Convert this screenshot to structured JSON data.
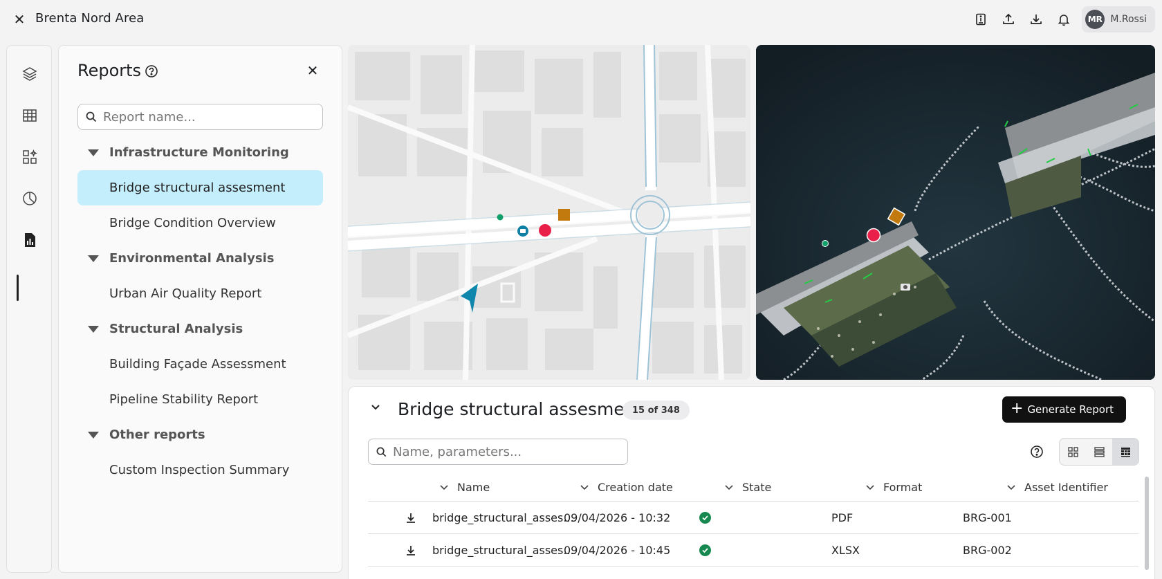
{
  "header": {
    "title": "Brenta Nord Area",
    "user": {
      "initials": "MR",
      "name": "M.Rossi"
    }
  },
  "rail": {
    "items": [
      {
        "name": "layers-icon"
      },
      {
        "name": "table-icon"
      },
      {
        "name": "widgets-icon"
      },
      {
        "name": "pie-chart-icon"
      },
      {
        "name": "report-icon",
        "active": true
      }
    ]
  },
  "reports_panel": {
    "title": "Reports",
    "search_placeholder": "Report name...",
    "groups": [
      {
        "label": "Infrastructure Monitoring",
        "items": [
          "Bridge structural assesment",
          "Bridge Condition Overview"
        ]
      },
      {
        "label": "Environmental Analysis",
        "items": [
          "Urban Air Quality Report"
        ]
      },
      {
        "label": "Structural Analysis",
        "items": [
          "Building Façade Assessment",
          "Pipeline Stability Report"
        ]
      },
      {
        "label": "Other reports",
        "items": [
          "Custom Inspection Summary"
        ]
      }
    ],
    "selected": "Bridge structural assesment"
  },
  "report": {
    "title": "Bridge structural assesment",
    "count": "15 of 348",
    "generate_label": "Generate Report",
    "search_placeholder": "Name, parameters...",
    "columns": [
      "Name",
      "Creation date",
      "State",
      "Format",
      "Asset Identifier"
    ],
    "rows": [
      {
        "name": "bridge_structural_asses...",
        "date": "09/04/2026 - 10:32",
        "state": "completed",
        "format": "PDF",
        "asset": "BRG-001"
      },
      {
        "name": "bridge_structural_asses...",
        "date": "09/04/2026 - 10:45",
        "state": "completed",
        "format": "XLSX",
        "asset": "BRG-002"
      }
    ]
  },
  "colors": {
    "selected_bg": "#c4eefc",
    "state_ok": "#17884f",
    "marker_red": "#e8204a",
    "marker_orange": "#c27a0e",
    "marker_green": "#11a06a",
    "marker_blue": "#0f7fa3"
  }
}
